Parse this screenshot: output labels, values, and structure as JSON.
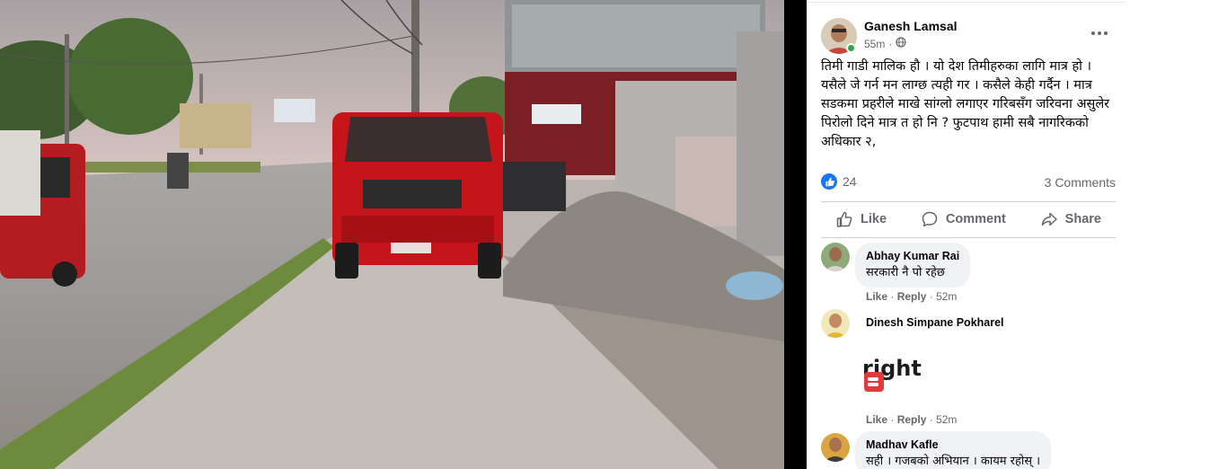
{
  "post": {
    "author": "Ganesh Lamsal",
    "time": "55m",
    "privacy_icon": "globe-icon",
    "text": "तिमी गाडी मालिक हौ । यो देश तिमीहरुका लागि मात्र हो । यसैले जे गर्न मन लाग्छ त्यही गर । कसैले केही गर्दैन । मात्र सडकमा प्रहरीले माखे सांग्लो लगाएर गरिबसँग जरिवना असुलेर पिरोलो दिने मात्र त हो नि ? फुटपाथ हामी सबै नागरिकको अधिकार २,",
    "reaction_count": "24",
    "comments_count": "3 Comments"
  },
  "actions": {
    "like": "Like",
    "comment": "Comment",
    "share": "Share"
  },
  "comments": [
    {
      "name": "Abhay Kumar Rai",
      "text": "सरकारी नै पो रहेछ",
      "like": "Like",
      "reply": "Reply",
      "time": "52m"
    },
    {
      "name": "Dinesh Simpane Pokharel",
      "sticker": "right.",
      "like": "Like",
      "reply": "Reply",
      "time": "52m"
    },
    {
      "name": "Madhav Kafle",
      "text": "सही । गजबको अभियान । कायम रहोस् ।"
    }
  ],
  "colors": {
    "accent": "#1877f2",
    "online": "#31a24c",
    "secondary_text": "#65676b"
  }
}
